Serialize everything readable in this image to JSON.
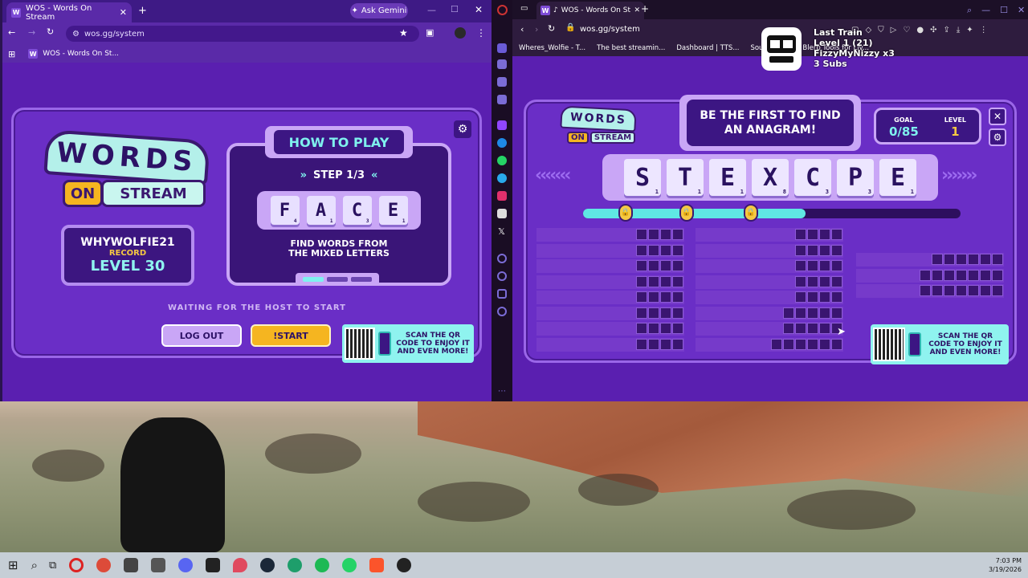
{
  "left_browser": {
    "tab_title": "WOS - Words On Stream",
    "ask_gemini": "Ask Gemini",
    "url": "wos.gg/system",
    "bookmark": "WOS - Words On St..."
  },
  "right_browser": {
    "tab_title": "WOS - Words On Strea",
    "url": "wos.gg/system",
    "bookmarks": [
      "Wheres_Wolfie - T...",
      "The best streamin...",
      "Dashboard | TTS...",
      "Sound Ale...",
      "Blerp Tools for Liv..."
    ]
  },
  "overlay": {
    "line1": "Last Train",
    "line2": "Level 1  (21)",
    "line3": "FizzyMyNizzy x3",
    "line4": "3 Subs"
  },
  "left_game": {
    "logo_top": "WORDS",
    "logo_on": "ON",
    "logo_stream": "STREAM",
    "player_name": "WHYWOLFIE21",
    "record_label": "RECORD",
    "level_text": "LEVEL 30",
    "how_to_play": "HOW TO PLAY",
    "step": "STEP 1/3",
    "example_tiles": [
      {
        "letter": "F",
        "points": "4"
      },
      {
        "letter": "A",
        "points": "1"
      },
      {
        "letter": "C",
        "points": "3"
      },
      {
        "letter": "E",
        "points": "1"
      }
    ],
    "hint_line1": "FIND WORDS FROM",
    "hint_line2": "THE MIXED LETTERS",
    "waiting": "WAITING FOR THE HOST TO START",
    "logout": "LOG OUT",
    "start": "!START",
    "qr_line1": "SCAN THE QR",
    "qr_line2": "CODE TO ENJOY IT",
    "qr_line3": "AND EVEN MORE!"
  },
  "right_game": {
    "banner_line1": "BE THE FIRST TO FIND",
    "banner_line2": "AN ANAGRAM!",
    "goal_label": "GOAL",
    "goal_value": "0/85",
    "level_label": "LEVEL",
    "level_value": "1",
    "progress": 0.59,
    "letters": [
      {
        "letter": "S",
        "points": "1"
      },
      {
        "letter": "T",
        "points": "1"
      },
      {
        "letter": "E",
        "points": "1"
      },
      {
        "letter": "X",
        "points": "8"
      },
      {
        "letter": "C",
        "points": "3"
      },
      {
        "letter": "P",
        "points": "3"
      },
      {
        "letter": "E",
        "points": "1"
      }
    ],
    "qr_line1": "SCAN THE QR",
    "qr_line2": "CODE TO ENJOY IT",
    "qr_line3": "AND EVEN MORE!"
  },
  "taskbar": {
    "time": "7:03 PM",
    "date": "3/19/2026"
  }
}
